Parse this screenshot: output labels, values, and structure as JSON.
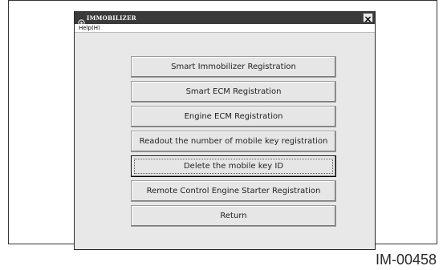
{
  "window": {
    "title": "IMMOBILIZER",
    "icon": "app-icon",
    "close_icon": "close-icon"
  },
  "menu": {
    "items": [
      {
        "label": "Help(H)"
      }
    ]
  },
  "buttons": [
    {
      "label": "Smart Immobilizer Registration",
      "focused": false
    },
    {
      "label": "Smart ECM Registration",
      "focused": false
    },
    {
      "label": "Engine ECM Registration",
      "focused": false
    },
    {
      "label": "Readout the number of mobile key registration",
      "focused": false
    },
    {
      "label": "Delete the mobile key ID",
      "focused": true
    },
    {
      "label": "Remote Control Engine Starter Registration",
      "focused": false
    },
    {
      "label": "Return",
      "focused": false
    }
  ],
  "figure_id": "IM-00458"
}
